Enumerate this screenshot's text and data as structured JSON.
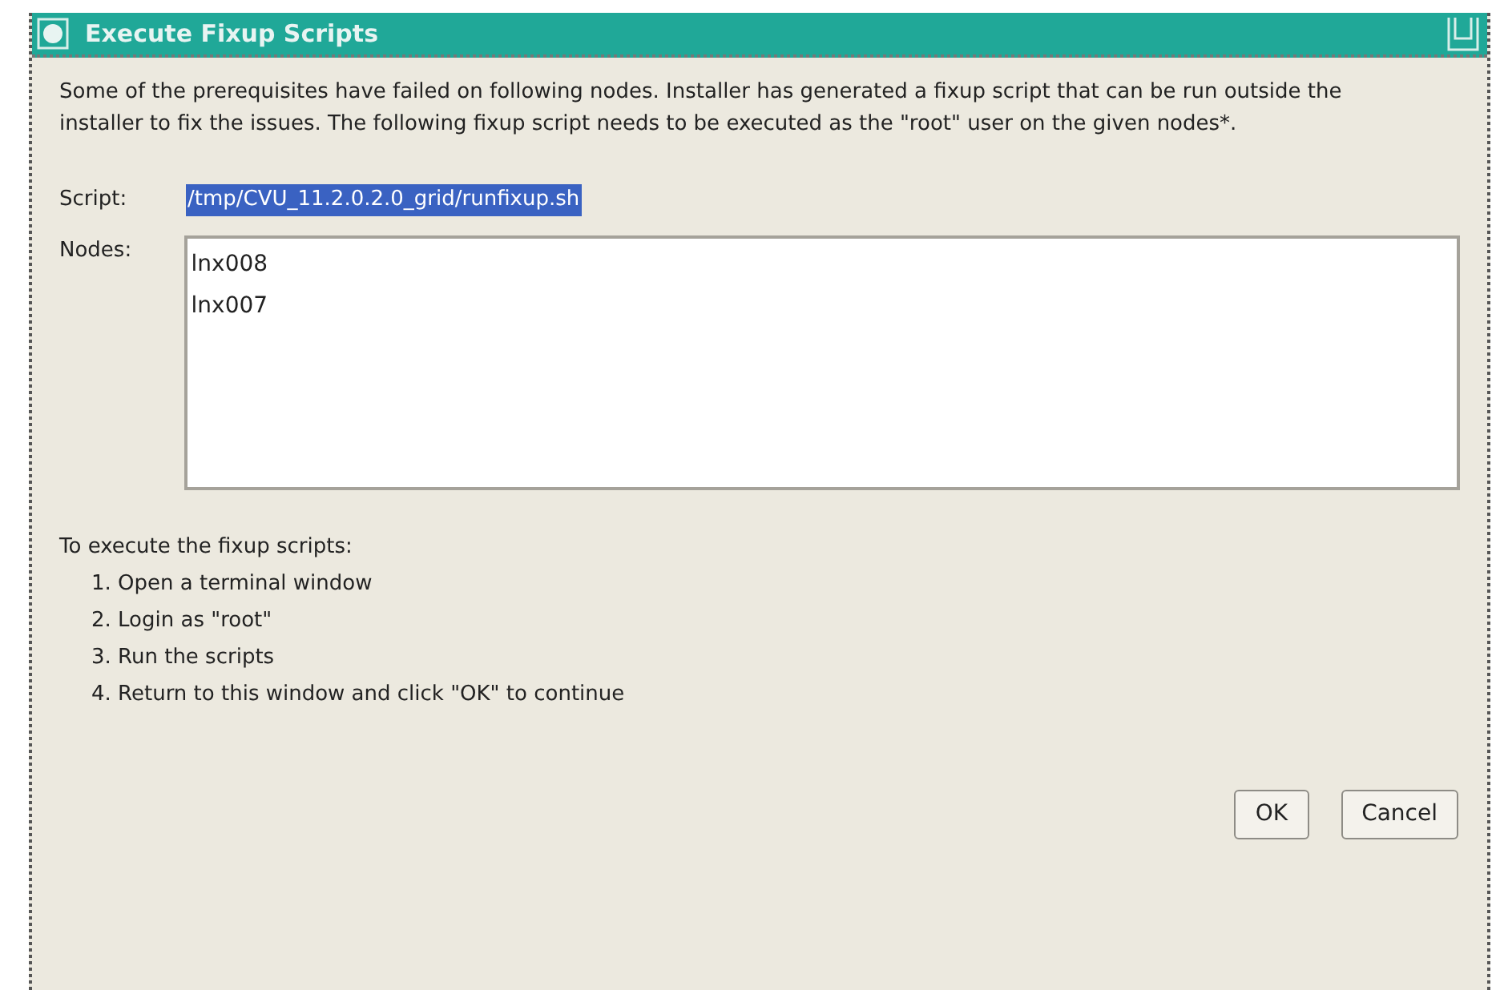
{
  "window": {
    "title": "Execute Fixup Scripts"
  },
  "message": "Some of the prerequisites have failed on following nodes. Installer has generated a fixup script that can be run outside the installer to fix the issues. The following fixup script needs to be executed as the \"root\" user on the given nodes*.",
  "script": {
    "label": "Script:",
    "value": "/tmp/CVU_11.2.0.2.0_grid/runfixup.sh",
    "selected": true
  },
  "nodes": {
    "label": "Nodes:",
    "items": [
      "lnx008",
      "lnx007"
    ]
  },
  "instructions": {
    "heading": "To execute the fixup scripts:",
    "steps": [
      "1. Open a terminal window",
      "2. Login as \"root\"",
      "3. Run the scripts",
      "4. Return to this window and click \"OK\" to continue"
    ]
  },
  "buttons": [
    "OK",
    "Cancel"
  ]
}
